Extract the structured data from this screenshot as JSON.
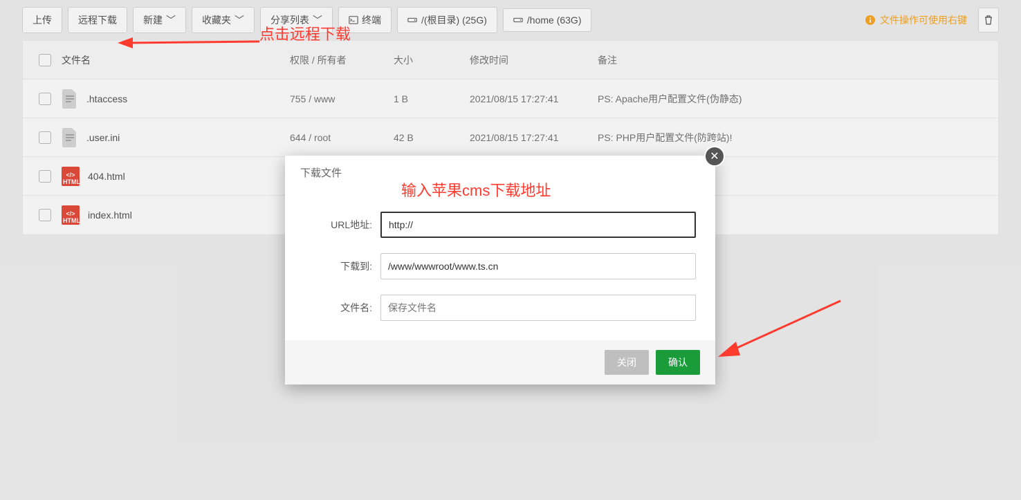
{
  "toolbar": {
    "upload": "上传",
    "remote_download": "远程下载",
    "new": "新建",
    "favorite": "收藏夹",
    "share_list": "分享列表",
    "terminal": "终端",
    "root_disk": "/(根目录)  (25G)",
    "home_disk": "/home  (63G)",
    "tip": "文件操作可使用右键"
  },
  "table": {
    "head": {
      "name": "文件名",
      "perm": "权限 / 所有者",
      "size": "大小",
      "date": "修改时间",
      "note": "备注"
    },
    "rows": [
      {
        "name": ".htaccess",
        "perm": "755 / www",
        "size": "1 B",
        "date": "2021/08/15 17:27:41",
        "note": "PS: Apache用户配置文件(伪静态)",
        "icon": "file"
      },
      {
        "name": ".user.ini",
        "perm": "644 / root",
        "size": "42 B",
        "date": "2021/08/15 17:27:41",
        "note": "PS: PHP用户配置文件(防跨站)!",
        "icon": "file"
      },
      {
        "name": "404.html",
        "perm": "",
        "size": "",
        "date": "",
        "note": "",
        "icon": "html"
      },
      {
        "name": "index.html",
        "perm": "",
        "size": "",
        "date": "",
        "note": "",
        "icon": "html"
      }
    ]
  },
  "modal": {
    "title": "下载文件",
    "url_label": "URL地址:",
    "url_value": "http://",
    "path_label": "下载到:",
    "path_value": "/www/wwwroot/www.ts.cn",
    "file_label": "文件名:",
    "file_placeholder": "保存文件名",
    "cancel": "关闭",
    "ok": "确认"
  },
  "annotations": {
    "a1": "点击远程下载",
    "a2": "输入苹果cms下载地址"
  }
}
